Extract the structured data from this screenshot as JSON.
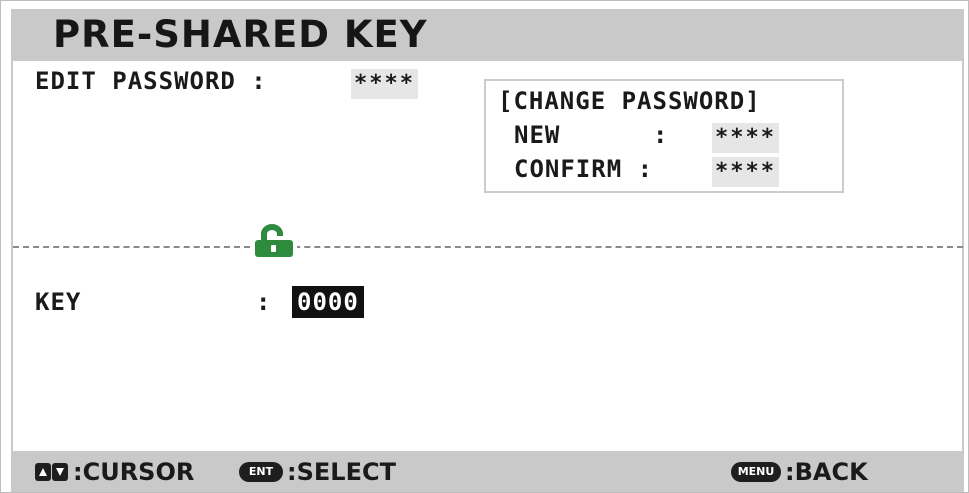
{
  "header": {
    "title": "PRE-SHARED KEY"
  },
  "edit_password": {
    "label": "EDIT PASSWORD :",
    "value": "****"
  },
  "change_password": {
    "title": "[CHANGE PASSWORD]",
    "new_label": "NEW      :",
    "new_value": "****",
    "confirm_label": "CONFIRM :",
    "confirm_value": "****"
  },
  "lock": {
    "icon": "unlocked-padlock-icon",
    "color": "#2e8b3e"
  },
  "key": {
    "label": "KEY",
    "separator": ":",
    "value": "0000"
  },
  "footer": {
    "cursor_icon": "up-down-arrow-keys-icon",
    "cursor_label": ":CURSOR",
    "select_key": "ENT",
    "select_label": ":SELECT",
    "back_key": "MENU",
    "back_label": ":BACK"
  }
}
